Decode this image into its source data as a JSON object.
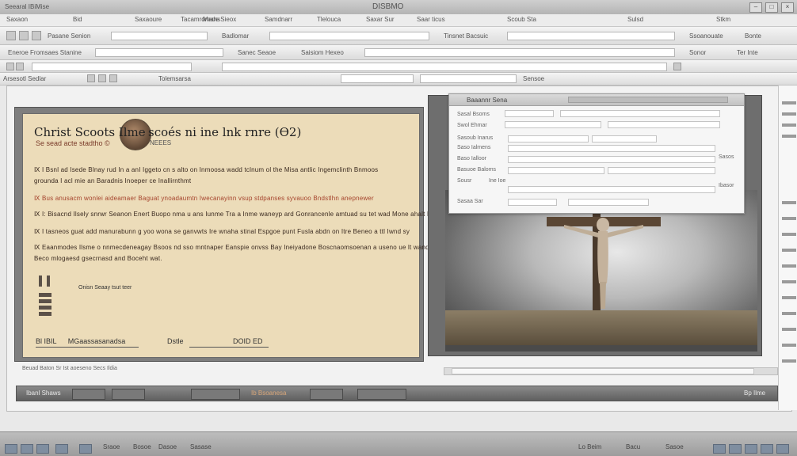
{
  "window": {
    "title": "DISBMO",
    "left_caption": "Seearal IBiMise",
    "controls": [
      "–",
      "□",
      "×"
    ]
  },
  "menu": {
    "items": [
      "Saxaon",
      "Bid",
      "Saxaoure",
      "Tacamrdmans",
      "Made Sieox",
      "Samdnarr",
      "Tlelouca",
      "Saxar Sur",
      "Saar ticus",
      "Scoub Sta",
      "Sulsd",
      "Stkm"
    ]
  },
  "toolbar": {
    "row1_labels": [
      "Pasane Senion",
      "Badlomar",
      "Tinsnet Bacsuic",
      "Ssoanouate",
      "Bonte"
    ],
    "row2_labels": [
      "Eneroe Fromsaes Stanine",
      "Sanec Seaoe",
      "Saisiom Hexeo",
      "Sonor",
      "Ter Inte"
    ],
    "row3_labels": [
      "Arsesotl Sedlar",
      "Tolemsarsa",
      "Sensoe"
    ]
  },
  "document": {
    "title": "Christ Scoots Ilme",
    "title_right": "scoés ni ine lnk rnre (Ѳ2)",
    "subtitle": "Se sead acte stadtho  ©",
    "subtitle_right": "NEEES",
    "lines": [
      "Ⅸ  I Bsnl ad Isede Blnay rud In a anI Iggeto cn s alto on Inmoosa wadd tclnum ol the Misa antlic Ingemclinth Bnmoos",
      "grounda I acl mie an Baradnis Inoeper ce Inallirnthmt",
      "Ⅸ  Bus anusacm wonlei aideamaer Baguat ynoadaumtn Iwecanayinn vsup stdpanses syvauoo Bndstlhn anepnewer",
      "Ⅸ  I: Bisacnd Ilsely snrwr Seanon Enert Buopo nma u ans Iunme Tra a Inme waneyp ard Gonrancenle amtuad su tet wad Mone ahalt Bl arte",
      "Ⅸ  I tasneos guat add manurabunn g yoo wona se ganvwts Ire wnaha stinal Espgoe punt Fusla abdn on Itre Beneo a ttl Iwnd sy",
      "Ⅸ  Eaanmodes Ilsme o nnmecdeneagay Bsoos nd sso mntnaper Eanspie onvss Bay Ineiyadone Boscnaomsoenan a useno ue lt wand e",
      "Beco mlogaesd gsecrnasd and Boceht wat."
    ],
    "stamp_caption": "Onisn Seaay tsut teer",
    "footer_left": "Bl  IBIL",
    "footer_left_sig": "MGaassasanadsa",
    "footer_right": "Dstle",
    "footer_right_sig": "DOID ED"
  },
  "dialog": {
    "title": "Baaannr Sena",
    "labels": [
      "Sasal Bsoms",
      "Swol Ehmar",
      "Sasoub Inarus",
      "Saso Ialmens",
      "Baso Ialloor",
      "Basuoe Baloms",
      "Sousr",
      "Ine Ioe",
      "Sasaa Sar"
    ],
    "right_labels": [
      "Sasos",
      "Ibasor"
    ]
  },
  "status": {
    "doc_status": "Beuad Baton  Sr  Ist aoeseno  Secs Ildia",
    "bottom_left": "Ibanl Shaws",
    "bottom_center": "Ib Bsoanesa",
    "bottom_right": "Bp Ilme"
  },
  "taskbar": {
    "items": [
      "Sraoe",
      "Bosoe",
      "Dasoe",
      "Sasase"
    ],
    "right_items": [
      "Lo Beim",
      "Bacu",
      "Sasoe"
    ]
  },
  "colors": {
    "accent_text": "#a5432c",
    "paper": "#ecdcb9"
  }
}
